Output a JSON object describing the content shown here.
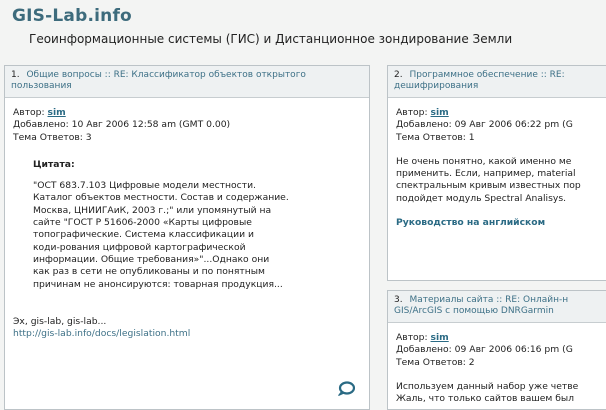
{
  "site": {
    "title": "GIS-Lab.info",
    "tagline": "Геоинформационные системы (ГИС) и Дистанционное зондирование Земли"
  },
  "posts": [
    {
      "number": "1.",
      "title": "Общие вопросы :: RE: Классификатор объектов открытого пользования",
      "author_label": "Автор:",
      "author": "sim",
      "added": "Добавлено: 10 Авг 2006 12:58 am (GMT 0.00)",
      "replies": "Тема Ответов: 3",
      "quote_label": "Цитата:",
      "quote_lines": [
        "\"ОСТ 683.7.103 Цифровые модели местности.",
        "Каталог объектов местности. Состав и содержание.",
        "Москва, ЦНИИГАиК, 2003 г.;\" или упомянутый на",
        "сайте \"ГОСТ Р 51606-2000 «Карты цифровые",
        "топографические. Система классификации и",
        "коди-рования цифровой картографической",
        "информации. Общие требования»\"...Однако они",
        "как раз в сети не опубликованы и по понятным",
        "причинам не анонсируются: товарная продукция..."
      ],
      "signature": "Эх, gis-lab, gis-lab...",
      "link": "http://gis-lab.info/docs/legislation.html"
    },
    {
      "number": "2.",
      "title_lines": [
        "Программное обеспечение :: RE: ",
        "дешифрирования"
      ],
      "author_label": "Автор:",
      "author": "sim",
      "added": "Добавлено: 09 Авг 2006 06:22 pm (G",
      "replies": "Тема Ответов: 1",
      "body_lines": [
        "Не очень понятно, какой именно ме",
        "применить. Если, например, material",
        "спектральным кривым известных пор",
        "подойдет модуль Spectral Analisys."
      ],
      "bold_link": "Руководство на английском"
    },
    {
      "number": "3.",
      "title_lines": [
        "Материалы сайта :: RE: Онлайн-н",
        "GIS/ArcGIS с помощью DNRGarmin"
      ],
      "author_label": "Автор:",
      "author": "sim",
      "added": "Добавлено: 09 Авг 2006 06:16 pm (G",
      "replies": "Тема Ответов: 2",
      "body_lines": [
        "Используем данный набор уже четве",
        "Жаль, что только сайтов вашем был"
      ]
    }
  ]
}
